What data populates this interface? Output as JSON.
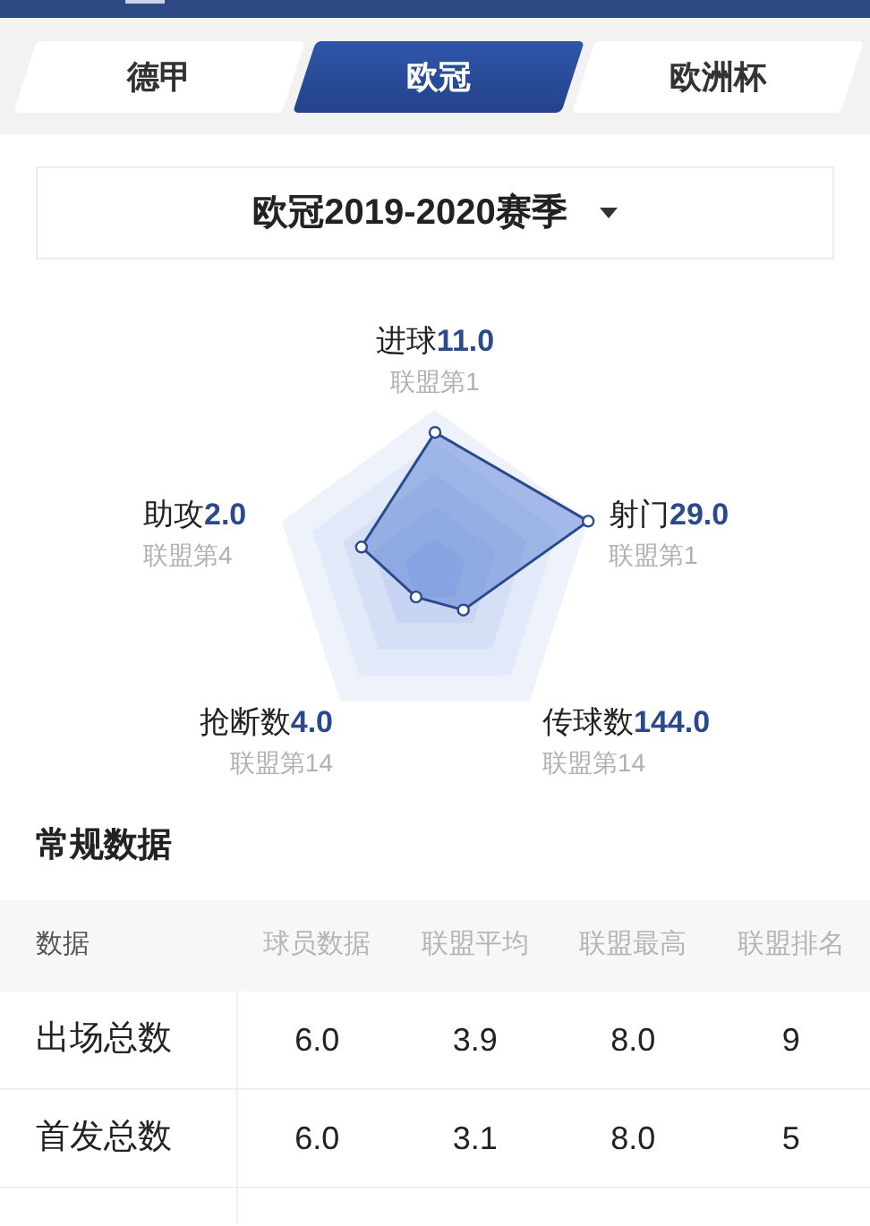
{
  "tabs": [
    {
      "label": "德甲",
      "selected": false
    },
    {
      "label": "欧冠",
      "selected": true
    },
    {
      "label": "欧洲杯",
      "selected": false
    }
  ],
  "season_dropdown": {
    "value": "欧冠2019-2020赛季"
  },
  "radar": {
    "axes": [
      {
        "name": "进球",
        "value": "11.0",
        "rank": "联盟第1"
      },
      {
        "name": "助攻",
        "value": "2.0",
        "rank": "联盟第4"
      },
      {
        "name": "射门",
        "value": "29.0",
        "rank": "联盟第1"
      },
      {
        "name": "抢断数",
        "value": "4.0",
        "rank": "联盟第14"
      },
      {
        "name": "传球数",
        "value": "144.0",
        "rank": "联盟第14"
      }
    ]
  },
  "section_title": "常规数据",
  "table": {
    "columns": [
      "数据",
      "球员数据",
      "联盟平均",
      "联盟最高",
      "联盟排名"
    ],
    "rows": [
      [
        "出场总数",
        "6.0",
        "3.9",
        "8.0",
        "9"
      ],
      [
        "首发总数",
        "6.0",
        "3.1",
        "8.0",
        "5"
      ]
    ]
  }
}
